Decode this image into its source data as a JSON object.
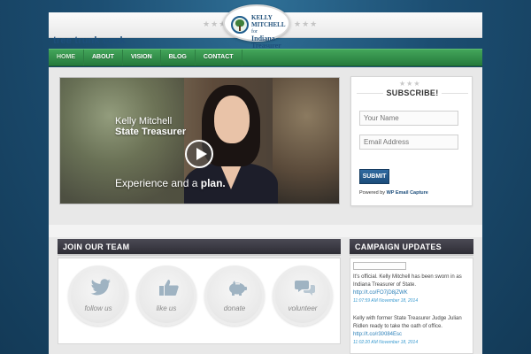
{
  "header": {
    "logo_lines": [
      "KELLY",
      "MITCHELL",
      "for",
      "Indiana",
      "Treasurer"
    ],
    "stars_left": "★★★",
    "stars_right": "★★★",
    "tagline": "tree trunk cock"
  },
  "nav": {
    "items": [
      {
        "label": "HOME",
        "active": true
      },
      {
        "label": "ABOUT",
        "active": false
      },
      {
        "label": "VISION",
        "active": false
      },
      {
        "label": "BLOG",
        "active": false
      },
      {
        "label": "CONTACT",
        "active": false
      }
    ]
  },
  "video": {
    "name": "Kelly Mitchell",
    "title": "State Treasurer",
    "slogan_prefix": "Experience and a ",
    "slogan_bold": "plan."
  },
  "subscribe": {
    "stars": "★★★",
    "title": "SUBSCRIBE!",
    "name_placeholder": "Your Name",
    "email_placeholder": "Email Address",
    "button": "SUBMIT",
    "powered_prefix": "Powered by ",
    "powered_link": "WP Email Capture"
  },
  "join": {
    "title": "JOIN OUR TEAM",
    "items": [
      {
        "label": "follow us",
        "icon": "twitter-bird-icon"
      },
      {
        "label": "like us",
        "icon": "thumbs-up-icon"
      },
      {
        "label": "donate",
        "icon": "piggy-bank-icon"
      },
      {
        "label": "volunteer",
        "icon": "speech-bubbles-icon"
      }
    ]
  },
  "campaign": {
    "title": "CAMPAIGN UPDATES",
    "tweets": [
      {
        "text": "It's official. Kelly Mitchell has been sworn in as Indiana Treasurer of State.",
        "link": "http://t.co/FO7jD8jZWK",
        "time": "11:07:59 AM November 18, 2014"
      },
      {
        "text": "Kelly with former State Treasurer Judge Julian Ridlen ready to take the oath of office.",
        "link": "http://t.co/r3lXl84Esc",
        "time": "11:02:20 AM November 18, 2014"
      }
    ]
  },
  "colors": {
    "background": "#1c4e72",
    "nav_green": "#2f8c48",
    "panel_header": "#3a3942",
    "button_blue": "#1b4c7a"
  }
}
